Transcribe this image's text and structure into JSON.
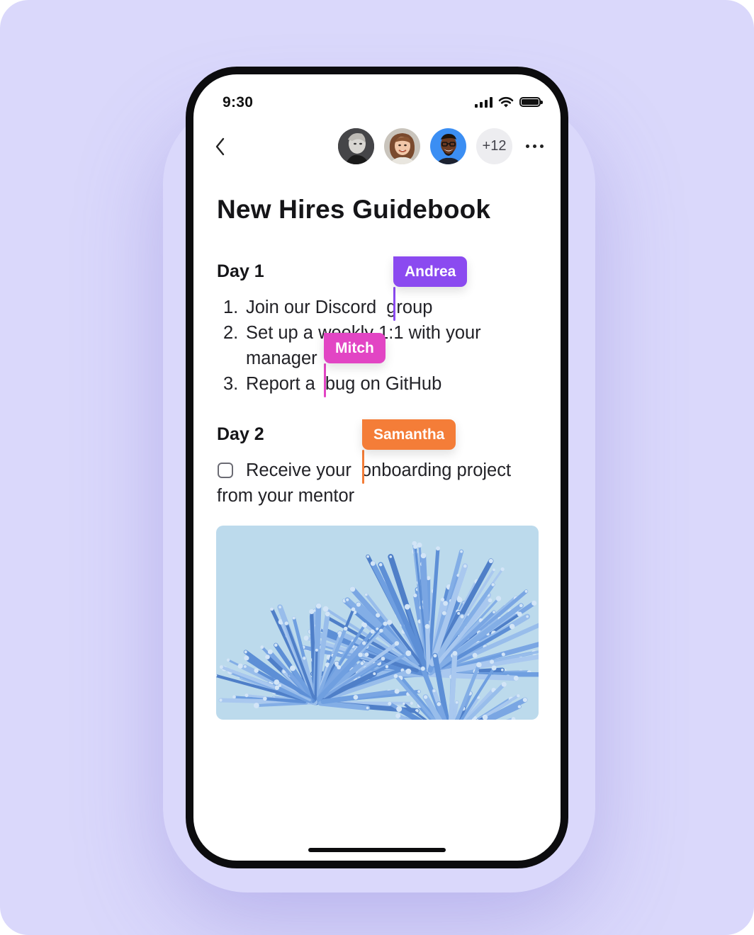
{
  "status_bar": {
    "time": "9:30"
  },
  "header": {
    "back_icon": "chevron-left-icon",
    "collaborators": [
      {
        "name": "collaborator-1",
        "style": "monochrome portrait"
      },
      {
        "name": "collaborator-2",
        "style": "portrait"
      },
      {
        "name": "collaborator-3",
        "style": "portrait on blue"
      }
    ],
    "more_collaborators": "+12",
    "more_icon": "ellipsis-icon"
  },
  "document": {
    "title": "New Hires Guidebook",
    "day1": {
      "heading": "Day 1",
      "items": [
        {
          "number": "1.",
          "text_a": "Join our Discord",
          "text_b": "group"
        },
        {
          "number": "2.",
          "text": "Set up a weekly 1:1 with  your",
          "continuation": "manager"
        },
        {
          "number": "3.",
          "text_a": "Report a",
          "text_b": "bug on GitHub"
        }
      ]
    },
    "day2": {
      "heading": "Day 2",
      "task": {
        "checked": false,
        "text_a": "Receive your",
        "text_b": "onboarding  project",
        "continuation": "from your mentor"
      }
    },
    "image": "abstract blue 3D cylinder sculpture"
  },
  "cursors": [
    {
      "name": "Andrea",
      "color": "#8b4af0"
    },
    {
      "name": "Mitch",
      "color": "#e245c4"
    },
    {
      "name": "Samantha",
      "color": "#f47d38"
    }
  ],
  "colors": {
    "background": "#dad8fb",
    "phone_frame": "#0c0c0e"
  }
}
